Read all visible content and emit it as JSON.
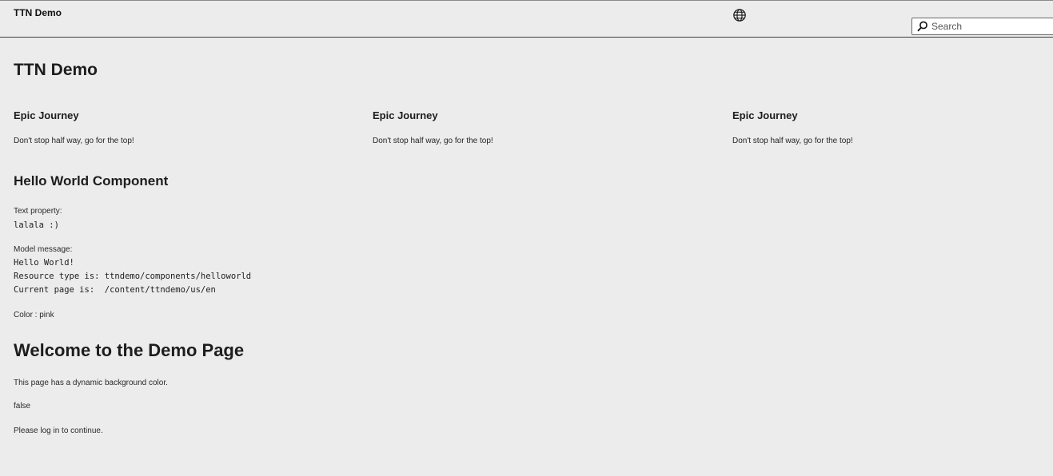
{
  "header": {
    "site_title": "TTN Demo",
    "language_icon": "globe-icon",
    "search": {
      "icon": "search-icon",
      "placeholder": "Search",
      "value": ""
    }
  },
  "main": {
    "title": "TTN Demo",
    "cards": [
      {
        "title": "Epic Journey",
        "text": "Don't stop half way, go for the top!"
      },
      {
        "title": "Epic Journey",
        "text": "Don't stop half way, go for the top!"
      },
      {
        "title": "Epic Journey",
        "text": "Don't stop half way, go for the top!"
      }
    ],
    "hello_world": {
      "title": "Hello World Component",
      "text_property_label": "Text property:",
      "text_property_value": "lalala :)",
      "model_message_label": "Model message:",
      "model_message_lines": [
        "Hello World!",
        "Resource type is: ttndemo/components/helloworld",
        "Current page is:  /content/ttndemo/us/en"
      ],
      "color_text": "Color : pink"
    },
    "welcome": {
      "title": "Welcome to the Demo Page",
      "description": "This page has a dynamic background color.",
      "boolean_value": "false",
      "login_message": "Please log in to continue."
    }
  }
}
